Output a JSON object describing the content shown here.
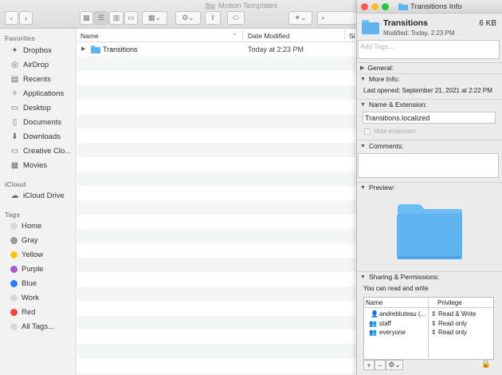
{
  "finder": {
    "window_title": "Motion Templates",
    "sidebar": {
      "favorites_header": "Favorites",
      "favorites": [
        {
          "label": "Dropbox",
          "icon": "dropbox-icon"
        },
        {
          "label": "AirDrop",
          "icon": "airdrop-icon"
        },
        {
          "label": "Recents",
          "icon": "recents-icon"
        },
        {
          "label": "Applications",
          "icon": "applications-icon"
        },
        {
          "label": "Desktop",
          "icon": "desktop-icon"
        },
        {
          "label": "Documents",
          "icon": "documents-icon"
        },
        {
          "label": "Downloads",
          "icon": "downloads-icon"
        },
        {
          "label": "Creative Clo...",
          "icon": "folder-icon"
        },
        {
          "label": "Movies",
          "icon": "movies-icon"
        }
      ],
      "icloud_header": "iCloud",
      "icloud": [
        {
          "label": "iCloud Drive",
          "icon": "cloud-icon"
        }
      ],
      "tags_header": "Tags",
      "tags": [
        {
          "label": "Home",
          "color": "#d8d8d8"
        },
        {
          "label": "Gray",
          "color": "#9b9b9b"
        },
        {
          "label": "Yellow",
          "color": "#f4c60f"
        },
        {
          "label": "Purple",
          "color": "#a55ad1"
        },
        {
          "label": "Blue",
          "color": "#2c7cf6"
        },
        {
          "label": "Work",
          "color": "#d8d8d8"
        },
        {
          "label": "Red",
          "color": "#f0483b"
        },
        {
          "label": "All Tags...",
          "color": "#d8d8d8"
        }
      ]
    },
    "columns": {
      "name": "Name",
      "date_modified": "Date Modified",
      "size": "Si"
    },
    "rows": [
      {
        "name": "Transitions",
        "date": "Today at 2:23 PM"
      }
    ]
  },
  "info": {
    "window_title": "Transitions Info",
    "name": "Transitions",
    "size": "6 KB",
    "modified": "Modified: Today, 2:23 PM",
    "tags_placeholder": "Add Tags...",
    "general_label": "General:",
    "more_info_label": "More Info:",
    "last_opened": "Last opened: September 21, 2021 at 2:22 PM",
    "name_ext_label": "Name & Extension:",
    "name_ext_value": "Transitions.localized",
    "hide_extension_label": "Hide extension",
    "comments_label": "Comments:",
    "preview_label": "Preview:",
    "sharing_label": "Sharing & Permissions:",
    "sharing_summary": "You can read and write",
    "perm_headers": {
      "name": "Name",
      "privilege": "Privilege"
    },
    "permissions": [
      {
        "name": "andrebluteau (...",
        "privilege": "Read & Write",
        "icon": "user-icon"
      },
      {
        "name": "staff",
        "privilege": "Read only",
        "icon": "group-icon"
      },
      {
        "name": "everyone",
        "privilege": "Read only",
        "icon": "group-icon"
      }
    ],
    "colors": {
      "folder": "#5fb4ef",
      "folder_tab": "#7cc4f4"
    }
  }
}
